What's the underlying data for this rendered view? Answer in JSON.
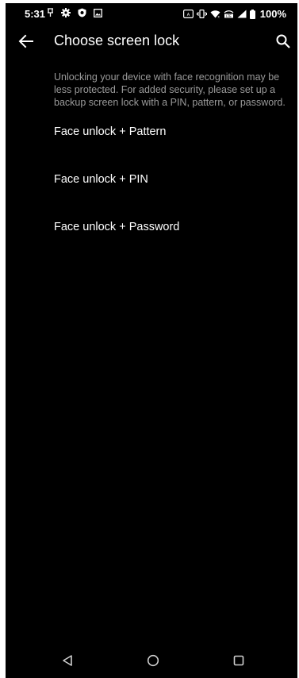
{
  "status_bar": {
    "time": "5:31",
    "battery": "100%",
    "left_icons": [
      "pin-icon",
      "gear-icon",
      "shield-icon",
      "image-icon"
    ],
    "right_icons": [
      "auto-brightness-icon",
      "vibrate-icon",
      "wifi-icon",
      "volte-icon",
      "signal-icon",
      "battery-icon"
    ]
  },
  "app_bar": {
    "title": "Choose screen lock",
    "back_icon": "arrow-back-icon",
    "search_icon": "search-icon"
  },
  "description": "Unlocking your device with face recognition may be less protected. For added security, please set up a backup screen lock with a PIN, pattern, or password.",
  "options": [
    {
      "label": "Face unlock + Pattern"
    },
    {
      "label": "Face unlock + PIN"
    },
    {
      "label": "Face unlock + Password"
    }
  ],
  "nav_bar": {
    "back_icon": "triangle-back-icon",
    "home_icon": "circle-home-icon",
    "recents_icon": "square-recents-icon"
  },
  "colors": {
    "background": "#000000",
    "text_primary": "#ffffff",
    "text_secondary": "#9a9a9a"
  }
}
